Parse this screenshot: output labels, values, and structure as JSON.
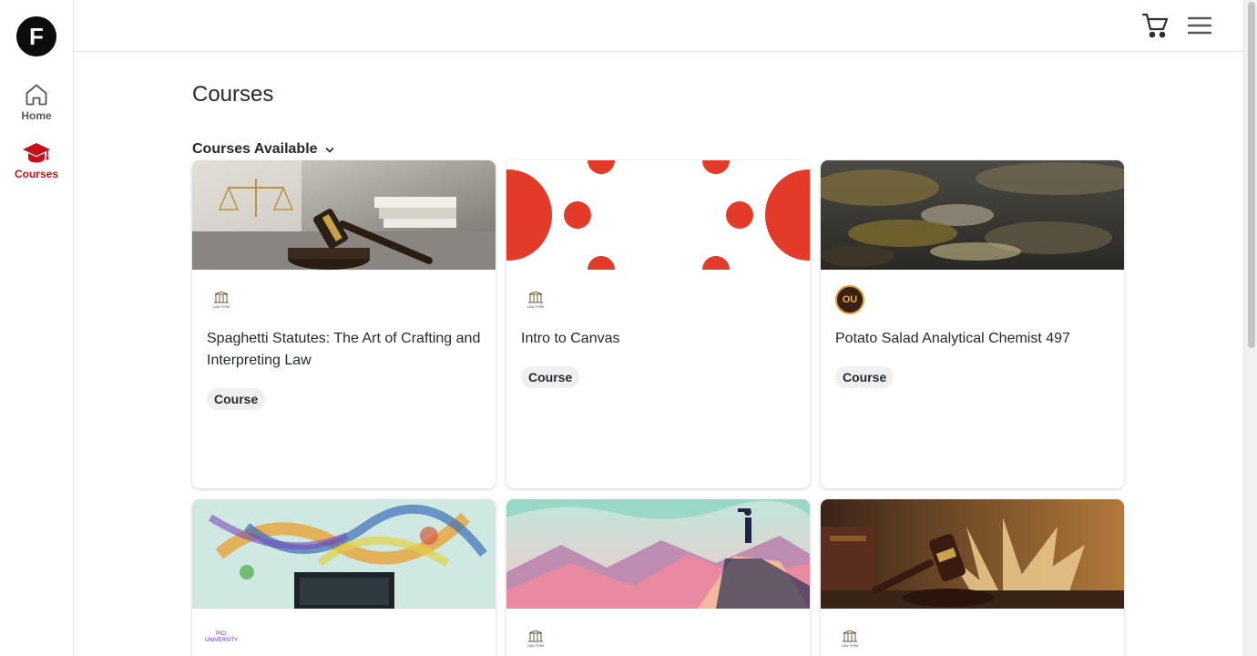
{
  "app": {
    "logo_letter": "F"
  },
  "sidebar": {
    "items": [
      {
        "label": "Home",
        "icon": "home-icon",
        "active": false
      },
      {
        "label": "Courses",
        "icon": "graduation-cap-icon",
        "active": true
      }
    ]
  },
  "topbar": {
    "cart_icon": "cart-icon",
    "menu_icon": "hamburger-menu-icon"
  },
  "page": {
    "title": "Courses",
    "filter_label": "Courses Available"
  },
  "courses": [
    {
      "title": "Spaghetti Statutes: The Art of Crafting and Interpreting Law",
      "badge": "Course",
      "org_logo": "law-firm-logo",
      "image": "gavel-and-scales-photo"
    },
    {
      "title": "Intro to Canvas",
      "badge": "Course",
      "org_logo": "law-firm-logo",
      "image": "red-dots-pattern"
    },
    {
      "title": "Potato Salad Analytical Chemist 497",
      "badge": "Course",
      "org_logo": "ou-logo",
      "image": "rocky-shoreline-photo"
    },
    {
      "title": "",
      "badge": "",
      "org_logo": "university-logo",
      "org_logo_text": "PICI UNIVERSITY",
      "image": "paint-splash-laptop-photo"
    },
    {
      "title": "",
      "badge": "",
      "org_logo": "law-firm-logo",
      "image": "mountain-peak-illustration"
    },
    {
      "title": "",
      "badge": "",
      "org_logo": "law-firm-logo",
      "image": "gavel-and-book-photo"
    }
  ],
  "org_logos": {
    "law_firm_text": "LAW FIRM",
    "ou_text": "OU"
  },
  "colors": {
    "accent": "#c8101a",
    "nav_inactive": "#55585d",
    "badge_bg": "#eef0f2"
  }
}
